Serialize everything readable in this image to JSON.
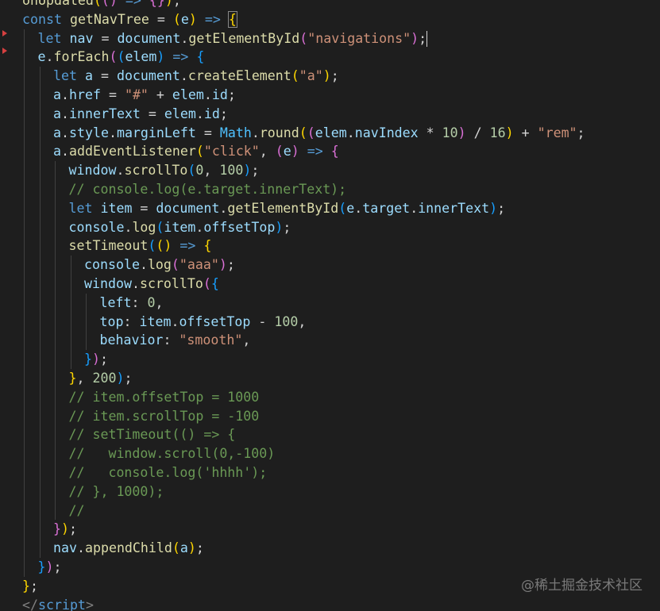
{
  "editor": {
    "theme_colors": {
      "background": "#1e1e1e",
      "keyword": "#569cd6",
      "function": "#dcdcaa",
      "variable": "#9cdcfe",
      "string": "#ce9178",
      "number": "#b5cea8",
      "comment": "#6a9955",
      "fold_marker": "#d64040"
    },
    "fold_markers": [
      "chevron-right-icon",
      "chevron-right-icon"
    ],
    "cursor_line": 2,
    "lines": [
      [
        [
          "onUpdated",
          "t-fn"
        ],
        [
          "(",
          "t-b1"
        ],
        [
          "(",
          "t-b2"
        ],
        [
          ")",
          "t-b2"
        ],
        [
          " => ",
          "t-kw"
        ],
        [
          "{",
          "t-b2"
        ],
        [
          "}",
          "t-b2"
        ],
        [
          ")",
          "t-b1"
        ],
        [
          ";",
          "t-punc"
        ]
      ],
      [
        [
          "const ",
          "t-kw"
        ],
        [
          "getNavTree",
          "t-fn"
        ],
        [
          " = ",
          "t-punc"
        ],
        [
          "(",
          "t-b1"
        ],
        [
          "e",
          "t-var"
        ],
        [
          ")",
          "t-b1"
        ],
        [
          " => ",
          "t-kw"
        ],
        [
          "{",
          "t-b1"
        ]
      ],
      [
        [
          "let ",
          "t-kw"
        ],
        [
          "nav",
          "t-var"
        ],
        [
          " = ",
          "t-punc"
        ],
        [
          "document",
          "t-var"
        ],
        [
          ".",
          "t-punc"
        ],
        [
          "getElementById",
          "t-fn"
        ],
        [
          "(",
          "t-b2"
        ],
        [
          "\"navigations\"",
          "t-str"
        ],
        [
          ")",
          "t-b2"
        ],
        [
          ";",
          "t-punc"
        ]
      ],
      [
        [
          "e",
          "t-var"
        ],
        [
          ".",
          "t-punc"
        ],
        [
          "forEach",
          "t-fn"
        ],
        [
          "(",
          "t-b2"
        ],
        [
          "(",
          "t-b3"
        ],
        [
          "elem",
          "t-var"
        ],
        [
          ")",
          "t-b3"
        ],
        [
          " => ",
          "t-kw"
        ],
        [
          "{",
          "t-b3"
        ]
      ],
      [
        [
          "let ",
          "t-kw"
        ],
        [
          "a",
          "t-var"
        ],
        [
          " = ",
          "t-punc"
        ],
        [
          "document",
          "t-var"
        ],
        [
          ".",
          "t-punc"
        ],
        [
          "createElement",
          "t-fn"
        ],
        [
          "(",
          "t-b1"
        ],
        [
          "\"a\"",
          "t-str"
        ],
        [
          ")",
          "t-b1"
        ],
        [
          ";",
          "t-punc"
        ]
      ],
      [
        [
          "a",
          "t-var"
        ],
        [
          ".",
          "t-punc"
        ],
        [
          "href",
          "t-var"
        ],
        [
          " = ",
          "t-punc"
        ],
        [
          "\"#\"",
          "t-str"
        ],
        [
          " + ",
          "t-punc"
        ],
        [
          "elem",
          "t-var"
        ],
        [
          ".",
          "t-punc"
        ],
        [
          "id",
          "t-var"
        ],
        [
          ";",
          "t-punc"
        ]
      ],
      [
        [
          "a",
          "t-var"
        ],
        [
          ".",
          "t-punc"
        ],
        [
          "innerText",
          "t-var"
        ],
        [
          " = ",
          "t-punc"
        ],
        [
          "elem",
          "t-var"
        ],
        [
          ".",
          "t-punc"
        ],
        [
          "id",
          "t-var"
        ],
        [
          ";",
          "t-punc"
        ]
      ],
      [
        [
          "a",
          "t-var"
        ],
        [
          ".",
          "t-punc"
        ],
        [
          "style",
          "t-var"
        ],
        [
          ".",
          "t-punc"
        ],
        [
          "marginLeft",
          "t-var"
        ],
        [
          " = ",
          "t-punc"
        ],
        [
          "Math",
          "t-const"
        ],
        [
          ".",
          "t-punc"
        ],
        [
          "round",
          "t-fn"
        ],
        [
          "(",
          "t-b1"
        ],
        [
          "(",
          "t-b2"
        ],
        [
          "elem",
          "t-var"
        ],
        [
          ".",
          "t-punc"
        ],
        [
          "navIndex",
          "t-var"
        ],
        [
          " * ",
          "t-punc"
        ],
        [
          "10",
          "t-num"
        ],
        [
          ")",
          "t-b2"
        ],
        [
          " / ",
          "t-punc"
        ],
        [
          "16",
          "t-num"
        ],
        [
          ")",
          "t-b1"
        ],
        [
          " + ",
          "t-punc"
        ],
        [
          "\"rem\"",
          "t-str"
        ],
        [
          ";",
          "t-punc"
        ]
      ],
      [
        [
          "a",
          "t-var"
        ],
        [
          ".",
          "t-punc"
        ],
        [
          "addEventListener",
          "t-fn"
        ],
        [
          "(",
          "t-b1"
        ],
        [
          "\"click\"",
          "t-str"
        ],
        [
          ", ",
          "t-punc"
        ],
        [
          "(",
          "t-b2"
        ],
        [
          "e",
          "t-var"
        ],
        [
          ")",
          "t-b2"
        ],
        [
          " => ",
          "t-kw"
        ],
        [
          "{",
          "t-b2"
        ]
      ],
      [
        [
          "window",
          "t-var"
        ],
        [
          ".",
          "t-punc"
        ],
        [
          "scrollTo",
          "t-fn"
        ],
        [
          "(",
          "t-b3"
        ],
        [
          "0",
          "t-num"
        ],
        [
          ", ",
          "t-punc"
        ],
        [
          "100",
          "t-num"
        ],
        [
          ")",
          "t-b3"
        ],
        [
          ";",
          "t-punc"
        ]
      ],
      [
        [
          "// console.log(e.target.innerText);",
          "t-com"
        ]
      ],
      [
        [
          "let ",
          "t-kw"
        ],
        [
          "item",
          "t-var"
        ],
        [
          " = ",
          "t-punc"
        ],
        [
          "document",
          "t-var"
        ],
        [
          ".",
          "t-punc"
        ],
        [
          "getElementById",
          "t-fn"
        ],
        [
          "(",
          "t-b3"
        ],
        [
          "e",
          "t-var"
        ],
        [
          ".",
          "t-punc"
        ],
        [
          "target",
          "t-var"
        ],
        [
          ".",
          "t-punc"
        ],
        [
          "innerText",
          "t-var"
        ],
        [
          ")",
          "t-b3"
        ],
        [
          ";",
          "t-punc"
        ]
      ],
      [
        [
          "console",
          "t-var"
        ],
        [
          ".",
          "t-punc"
        ],
        [
          "log",
          "t-fn"
        ],
        [
          "(",
          "t-b3"
        ],
        [
          "item",
          "t-var"
        ],
        [
          ".",
          "t-punc"
        ],
        [
          "offsetTop",
          "t-var"
        ],
        [
          ")",
          "t-b3"
        ],
        [
          ";",
          "t-punc"
        ]
      ],
      [
        [
          "setTimeout",
          "t-fn"
        ],
        [
          "(",
          "t-b3"
        ],
        [
          "(",
          "t-b1"
        ],
        [
          ")",
          "t-b1"
        ],
        [
          " => ",
          "t-kw"
        ],
        [
          "{",
          "t-b1"
        ]
      ],
      [
        [
          "console",
          "t-var"
        ],
        [
          ".",
          "t-punc"
        ],
        [
          "log",
          "t-fn"
        ],
        [
          "(",
          "t-b2"
        ],
        [
          "\"aaa\"",
          "t-str"
        ],
        [
          ")",
          "t-b2"
        ],
        [
          ";",
          "t-punc"
        ]
      ],
      [
        [
          "window",
          "t-var"
        ],
        [
          ".",
          "t-punc"
        ],
        [
          "scrollTo",
          "t-fn"
        ],
        [
          "(",
          "t-b2"
        ],
        [
          "{",
          "t-b3"
        ]
      ],
      [
        [
          "left",
          "t-var"
        ],
        [
          ": ",
          "t-punc"
        ],
        [
          "0",
          "t-num"
        ],
        [
          ",",
          "t-punc"
        ]
      ],
      [
        [
          "top",
          "t-var"
        ],
        [
          ": ",
          "t-punc"
        ],
        [
          "item",
          "t-var"
        ],
        [
          ".",
          "t-punc"
        ],
        [
          "offsetTop",
          "t-var"
        ],
        [
          " - ",
          "t-punc"
        ],
        [
          "100",
          "t-num"
        ],
        [
          ",",
          "t-punc"
        ]
      ],
      [
        [
          "behavior",
          "t-var"
        ],
        [
          ": ",
          "t-punc"
        ],
        [
          "\"smooth\"",
          "t-str"
        ],
        [
          ",",
          "t-punc"
        ]
      ],
      [
        [
          "}",
          "t-b3"
        ],
        [
          ")",
          "t-b2"
        ],
        [
          ";",
          "t-punc"
        ]
      ],
      [
        [
          "}",
          "t-b1"
        ],
        [
          ", ",
          "t-punc"
        ],
        [
          "200",
          "t-num"
        ],
        [
          ")",
          "t-b3"
        ],
        [
          ";",
          "t-punc"
        ]
      ],
      [
        [
          "// item.offsetTop = 1000",
          "t-com"
        ]
      ],
      [
        [
          "// item.scrollTop = -100",
          "t-com"
        ]
      ],
      [
        [
          "// setTimeout(() => {",
          "t-com"
        ]
      ],
      [
        [
          "//   window.scroll(0,-100)",
          "t-com"
        ]
      ],
      [
        [
          "//   console.log('hhhh');",
          "t-com"
        ]
      ],
      [
        [
          "// }, 1000);",
          "t-com"
        ]
      ],
      [
        [
          "//",
          "t-com"
        ]
      ],
      [
        [
          "}",
          "t-b2"
        ],
        [
          ")",
          "t-b1"
        ],
        [
          ";",
          "t-punc"
        ]
      ],
      [
        [
          "nav",
          "t-var"
        ],
        [
          ".",
          "t-punc"
        ],
        [
          "appendChild",
          "t-fn"
        ],
        [
          "(",
          "t-b1"
        ],
        [
          "a",
          "t-var"
        ],
        [
          ")",
          "t-b1"
        ],
        [
          ";",
          "t-punc"
        ]
      ],
      [
        [
          "}",
          "t-b3"
        ],
        [
          ")",
          "t-b2"
        ],
        [
          ";",
          "t-punc"
        ]
      ],
      [
        [
          "}",
          "t-b1"
        ],
        [
          ";",
          "t-punc"
        ]
      ],
      [
        [
          "</",
          "t-tag"
        ],
        [
          "script",
          "t-tagname"
        ],
        [
          ">",
          "t-tag"
        ]
      ]
    ],
    "indents": [
      0,
      0,
      1,
      1,
      2,
      2,
      2,
      2,
      2,
      3,
      3,
      3,
      3,
      3,
      4,
      4,
      5,
      5,
      5,
      4,
      3,
      3,
      3,
      3,
      3,
      3,
      3,
      3,
      2,
      2,
      1,
      0,
      0
    ]
  },
  "watermark": "@稀土掘金技术社区"
}
